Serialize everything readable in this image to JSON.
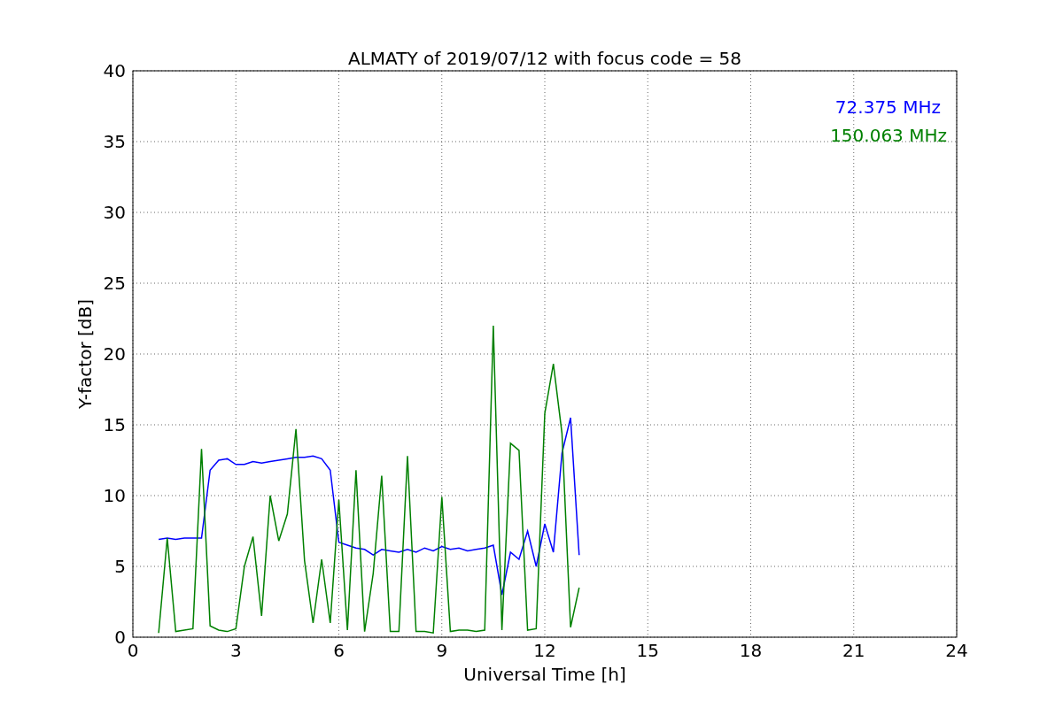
{
  "figure": {
    "chart_data": {
      "type": "line",
      "title": "ALMATY of 2019/07/12 with focus code = 58",
      "xlabel": "Universal Time [h]",
      "ylabel": "Y-factor [dB]",
      "x": [
        0.75,
        1,
        1.25,
        1.5,
        1.75,
        2,
        2.25,
        2.5,
        2.75,
        3,
        3.25,
        3.5,
        3.75,
        4,
        4.25,
        4.5,
        4.75,
        5,
        5.25,
        5.5,
        5.75,
        6,
        6.25,
        6.5,
        6.75,
        7,
        7.25,
        7.5,
        7.75,
        8,
        8.25,
        8.5,
        8.75,
        9,
        9.25,
        9.5,
        9.75,
        10,
        10.25,
        10.5,
        10.75,
        11,
        11.25,
        11.5,
        11.75,
        12,
        12.25,
        12.5,
        12.75,
        13
      ],
      "series": [
        {
          "name": "72.375 MHz",
          "color": "#0000ff",
          "values": [
            6.9,
            7.0,
            6.9,
            7.0,
            7.0,
            7.0,
            11.8,
            12.5,
            12.6,
            12.2,
            12.2,
            12.4,
            12.3,
            12.4,
            12.5,
            12.6,
            12.7,
            12.7,
            12.8,
            12.6,
            11.8,
            6.7,
            6.5,
            6.3,
            6.2,
            5.8,
            6.2,
            6.1,
            6.0,
            6.2,
            6.0,
            6.3,
            6.1,
            6.4,
            6.2,
            6.3,
            6.1,
            6.2,
            6.3,
            6.5,
            3.0,
            6.0,
            5.5,
            7.5,
            5.0,
            8.0,
            6.0,
            13.0,
            15.5,
            5.8
          ]
        },
        {
          "name": "150.063 MHz",
          "color": "#008000",
          "values": [
            0.3,
            7.0,
            0.4,
            0.5,
            0.6,
            13.3,
            0.8,
            0.5,
            0.4,
            0.6,
            5.0,
            7.1,
            1.5,
            10.0,
            6.8,
            8.7,
            14.7,
            5.4,
            1.0,
            5.5,
            1.0,
            9.7,
            0.5,
            11.8,
            0.4,
            4.5,
            11.4,
            0.4,
            0.4,
            12.8,
            0.4,
            0.4,
            0.3,
            9.9,
            0.4,
            0.5,
            0.5,
            0.4,
            0.5,
            22.0,
            0.5,
            13.7,
            13.2,
            0.5,
            0.6,
            15.8,
            19.3,
            14.4,
            0.7,
            3.5
          ]
        }
      ],
      "xlim": [
        0,
        24
      ],
      "ylim": [
        0,
        40
      ],
      "xticks": [
        0,
        3,
        6,
        9,
        12,
        15,
        18,
        21,
        24
      ],
      "yticks": [
        0,
        5,
        10,
        15,
        20,
        25,
        30,
        35,
        40
      ],
      "grid": true
    }
  }
}
